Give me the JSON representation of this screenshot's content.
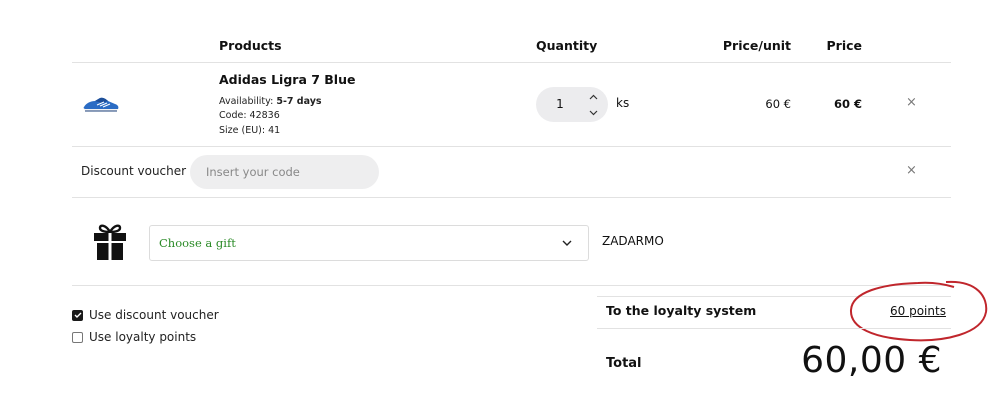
{
  "table_header": {
    "products": "Products",
    "quantity": "Quantity",
    "price_unit": "Price/unit",
    "price": "Price"
  },
  "product": {
    "name": "Adidas Ligra 7 Blue",
    "availability_label": "Availability:",
    "availability_value": "5-7 days",
    "code": "Code: 42836",
    "size": "Size (EU): 41",
    "quantity": "1",
    "unit": "ks",
    "price_unit": "60 €",
    "price": "60 €",
    "image_icon": "sneaker-image",
    "remove_icon": "close-icon",
    "remove_glyph": "×"
  },
  "voucher": {
    "label": "Discount voucher",
    "placeholder": "Insert your code",
    "remove_glyph": "×"
  },
  "gift": {
    "icon": "gift-icon",
    "select_label": "Choose a gift",
    "price_text": "ZADARMO",
    "select_text_color": "#2a8a26"
  },
  "options": {
    "use_voucher": {
      "label": "Use discount voucher",
      "checked": true
    },
    "use_points": {
      "label": "Use loyalty points",
      "checked": false
    }
  },
  "summary": {
    "loyalty_label": "To the loyalty system",
    "loyalty_points": "60 points",
    "total_label": "Total",
    "total_value": "60,00 €",
    "highlight_color": "#c0262c"
  }
}
